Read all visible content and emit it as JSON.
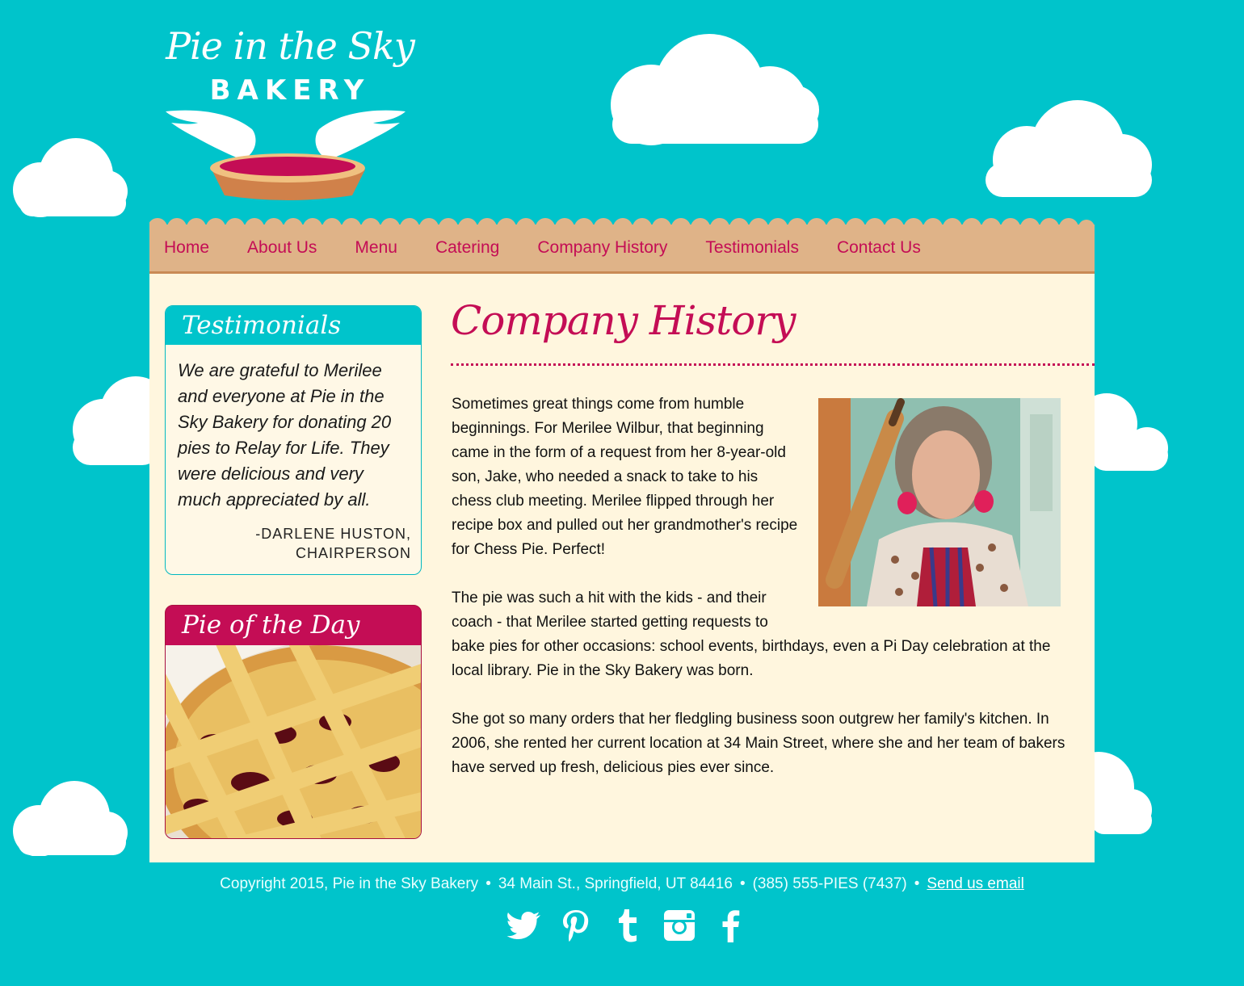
{
  "brand": {
    "script_name": "Pie in the Sky",
    "sub_name": "BAKERY"
  },
  "nav": {
    "items": [
      {
        "label": "Home"
      },
      {
        "label": "About Us"
      },
      {
        "label": "Menu"
      },
      {
        "label": "Catering"
      },
      {
        "label": "Company History"
      },
      {
        "label": "Testimonials"
      },
      {
        "label": "Contact Us"
      }
    ]
  },
  "sidebar": {
    "testimonials": {
      "title": "Testimonials",
      "quote": "We are grateful to Merilee and everyone at Pie in the Sky Bakery for donating 20 pies to Relay for Life. They were delicious and very much appreciated by all.",
      "attribution_line1": "-DARLENE HUSTON,",
      "attribution_line2": "CHAIRPERSON"
    },
    "pie_of_the_day": {
      "title": "Pie of the Day"
    }
  },
  "main": {
    "title": "Company History",
    "paragraphs": [
      "Sometimes great things come from humble beginnings. For Merilee Wilbur, that beginning came in the form of a request from her 8-year-old son, Jake, who needed a snack to take to his chess club meeting. Merilee flipped through her recipe box and pulled out her grandmother's recipe for Chess Pie. Perfect!",
      "The pie was such a hit with the kids - and their coach - that Merilee started getting requests to bake pies for other occasions: school events, birthdays, even a Pi Day celebration at the local library. Pie in the Sky Bakery was born.",
      "She got so many orders that her fledgling business soon outgrew her family's kitchen. In 2006, she rented her current location at 34 Main Street, where she and her team of bakers have served up fresh, delicious pies ever since."
    ]
  },
  "footer": {
    "copyright": "Copyright 2015, Pie in the Sky Bakery",
    "address": "34 Main St., Springfield, UT 84416",
    "phone": "(385) 555-PIES (7437)",
    "separator": "•",
    "email_link": "Send us email"
  },
  "social": [
    "twitter-icon",
    "pinterest-icon",
    "tumblr-icon",
    "instagram-icon",
    "facebook-icon"
  ],
  "colors": {
    "sky": "#00c4cb",
    "accent": "#c40d55",
    "nav_bg": "#dfb388",
    "content_bg": "#fff6de"
  }
}
